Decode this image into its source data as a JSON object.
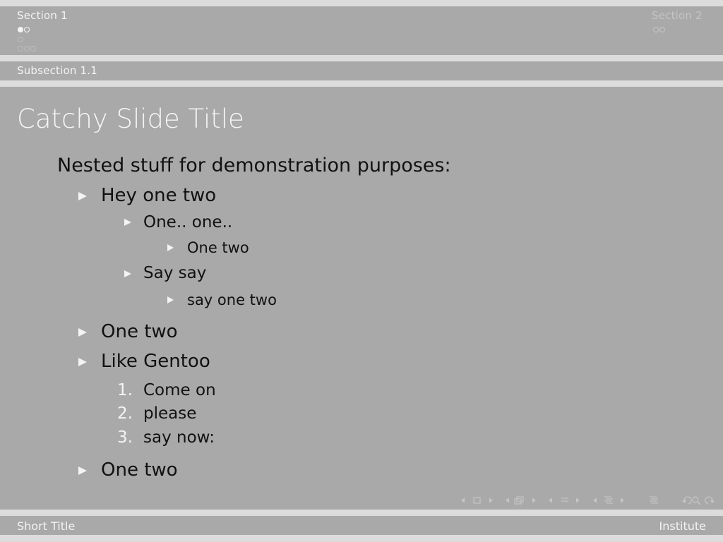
{
  "header": {
    "section1": "Section 1",
    "section2": "Section 2",
    "subsection": "Subsection 1.1"
  },
  "slide": {
    "title": "Catchy Slide Title",
    "intro": "Nested stuff for demonstration purposes:",
    "items": {
      "i1": "Hey one two",
      "i1a": "One.. one..",
      "i1a1": "One two",
      "i1b": "Say say",
      "i1b1": "say one two",
      "i2": "One two",
      "i3": "Like Gentoo",
      "i3n1_num": "1.",
      "i3n1": "Come on",
      "i3n2_num": "2.",
      "i3n2": "please",
      "i3n3_num": "3.",
      "i3n3": "say now:",
      "i4": "One two"
    }
  },
  "footer": {
    "left": "Short Title",
    "right": "Institute"
  },
  "colors": {
    "background": "#a9a9a9",
    "band": "#dcdcdc",
    "text": "#111111",
    "accent": "#f4f4f4"
  }
}
